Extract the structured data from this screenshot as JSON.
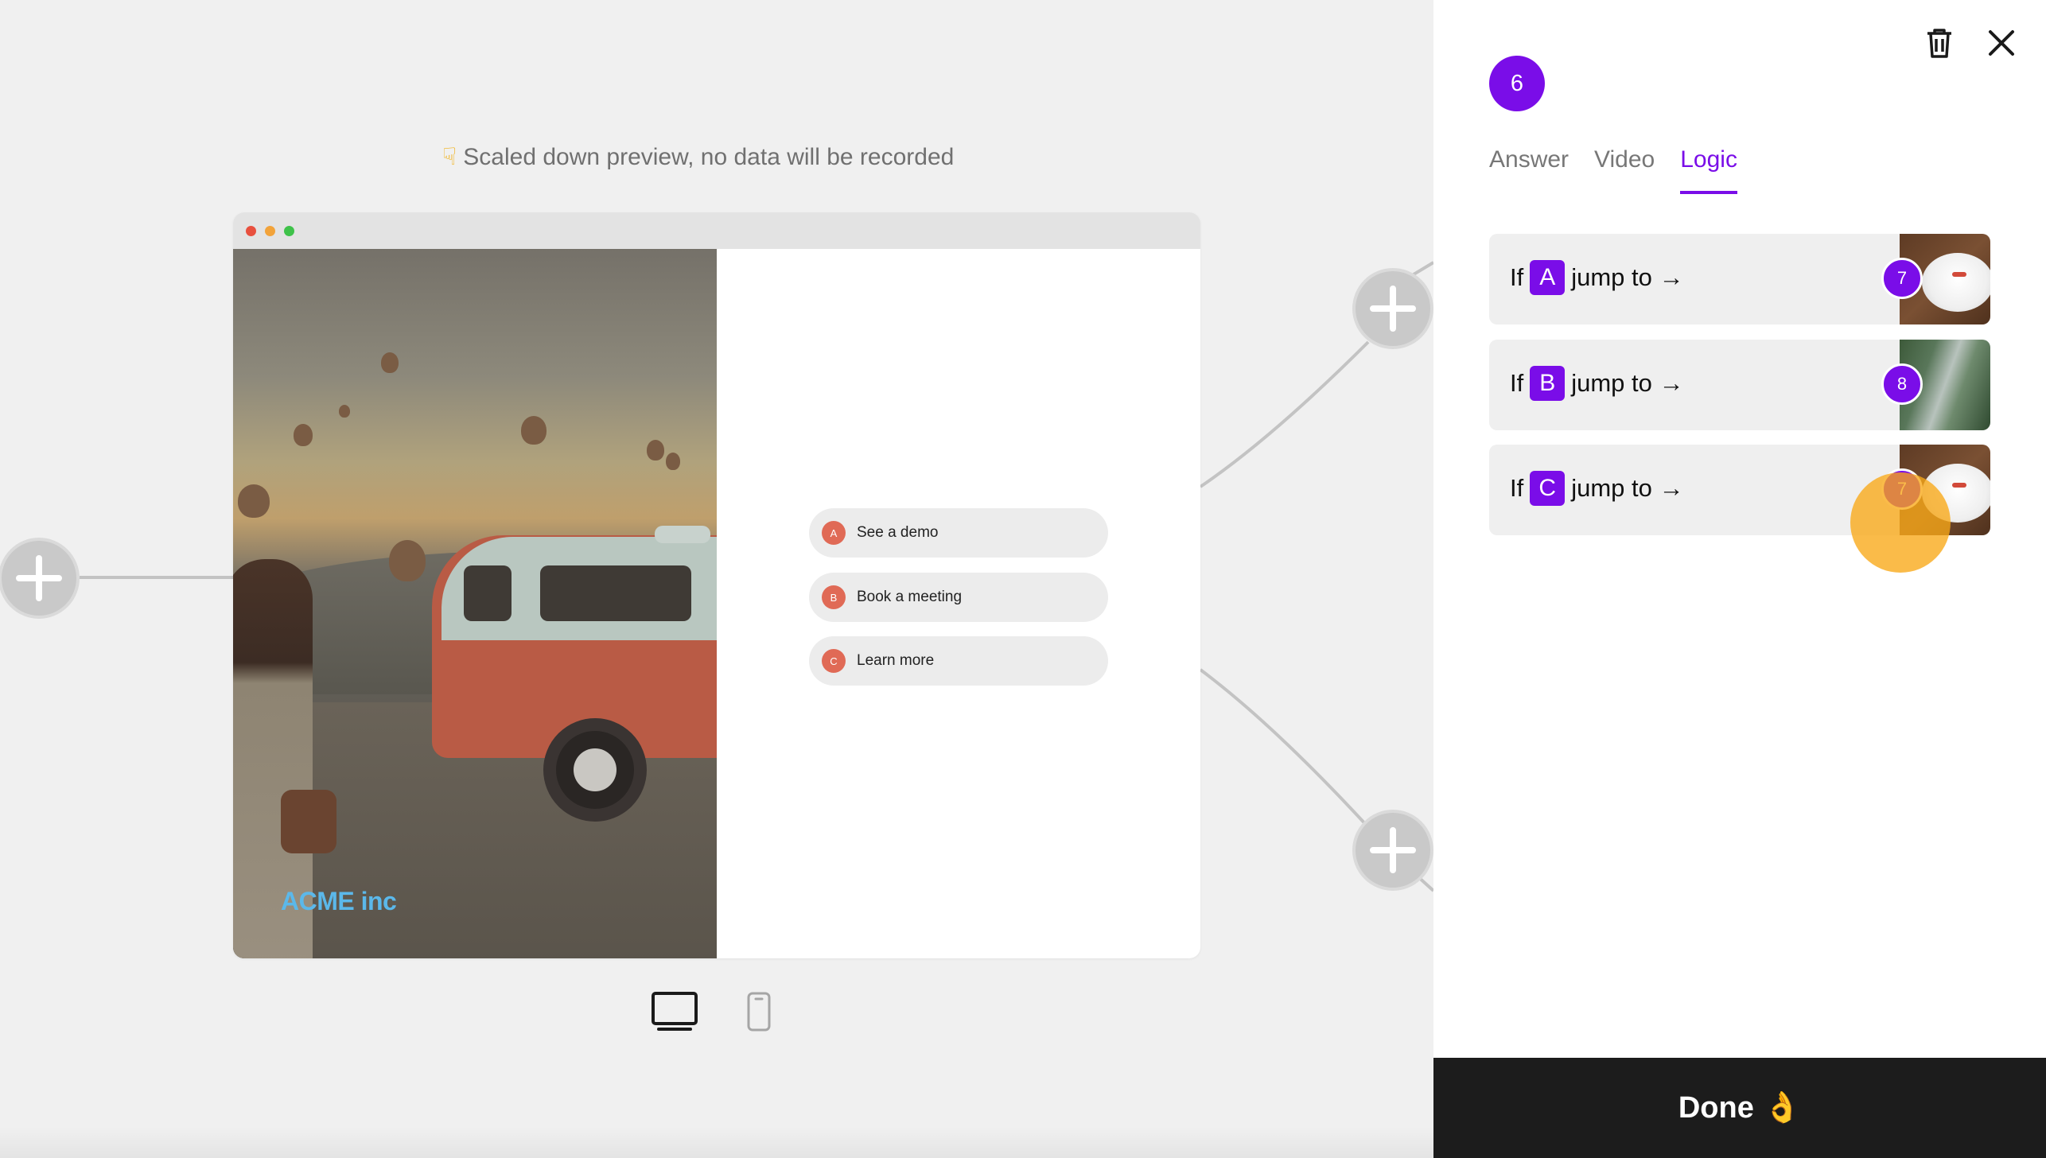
{
  "preview": {
    "note": "Scaled down preview, no data will be recorded",
    "note_icon": "pointing-down-hand-icon",
    "brand_text": "ACME inc",
    "answers": [
      {
        "letter": "A",
        "label": "See a demo"
      },
      {
        "letter": "B",
        "label": "Book a meeting"
      },
      {
        "letter": "C",
        "label": "Learn more"
      }
    ],
    "device_options": [
      "desktop-icon",
      "mobile-icon"
    ],
    "selected_device": "desktop"
  },
  "panel": {
    "step_number": "6",
    "tabs": [
      {
        "label": "Answer",
        "active": false
      },
      {
        "label": "Video",
        "active": false
      },
      {
        "label": "Logic",
        "active": true
      }
    ],
    "rules": [
      {
        "prefix": "If",
        "letter": "A",
        "suffix": "jump to →",
        "target": "7"
      },
      {
        "prefix": "If",
        "letter": "B",
        "suffix": "jump to →",
        "target": "8"
      },
      {
        "prefix": "If",
        "letter": "C",
        "suffix": "jump to →",
        "target": "7"
      }
    ],
    "done": {
      "label": "Done",
      "emoji": "👌"
    }
  },
  "colors": {
    "accent": "#7a0de8",
    "answer_letter": "#e06a56",
    "brand": "#5bb8ea",
    "done_bg": "#1c1c1c",
    "highlight": "#f8a816"
  }
}
